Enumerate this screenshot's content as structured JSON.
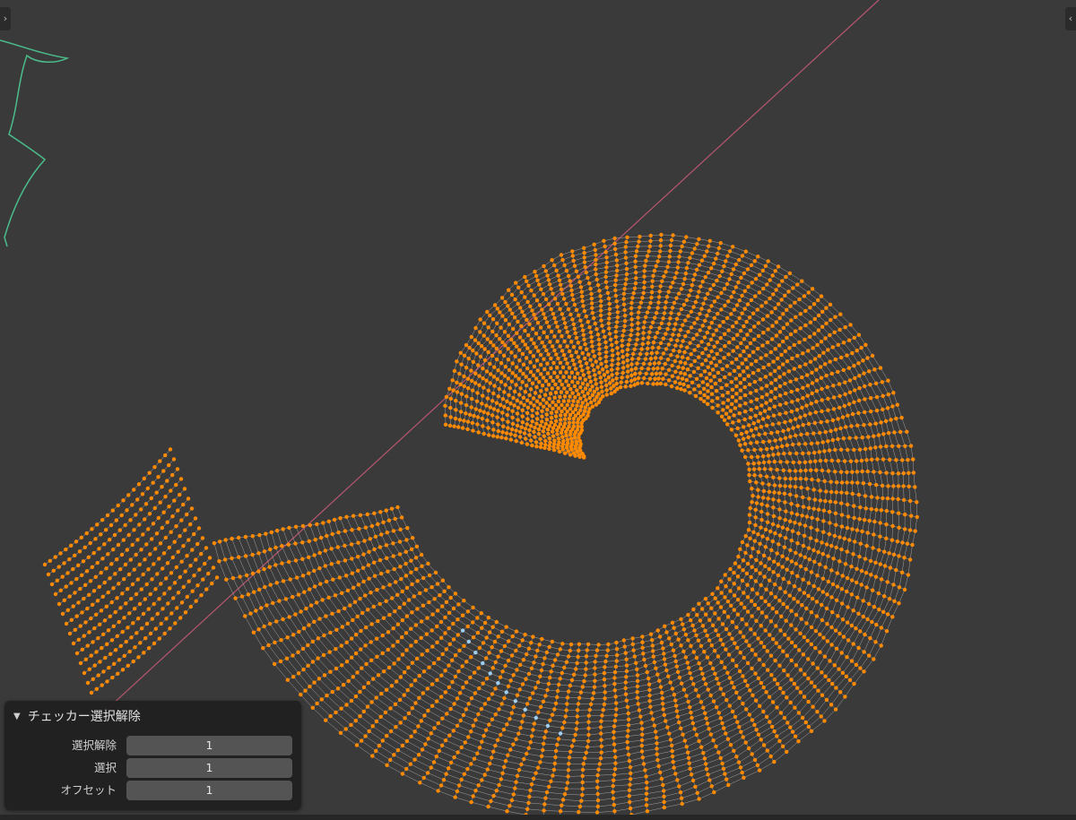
{
  "viewport": {
    "background": "#3a3a3a",
    "vertex_color": "#ff8a00",
    "wire_color": "#b4b4b4",
    "unselected_vertex_color": "#9ecff0",
    "axis_line_color": "#b8566f",
    "curve_color": "#4bbd8c",
    "toggle_left_icon": "chevron-right",
    "toggle_right_icon": "chevron-left",
    "toggle_left_glyph": "›",
    "toggle_right_glyph": "‹"
  },
  "redo_panel": {
    "title": "チェッカー選択解除",
    "collapse_glyph": "▼",
    "fields": [
      {
        "label": "選択解除",
        "value": "1"
      },
      {
        "label": "選択",
        "value": "1"
      },
      {
        "label": "オフセット",
        "value": "1"
      }
    ]
  }
}
